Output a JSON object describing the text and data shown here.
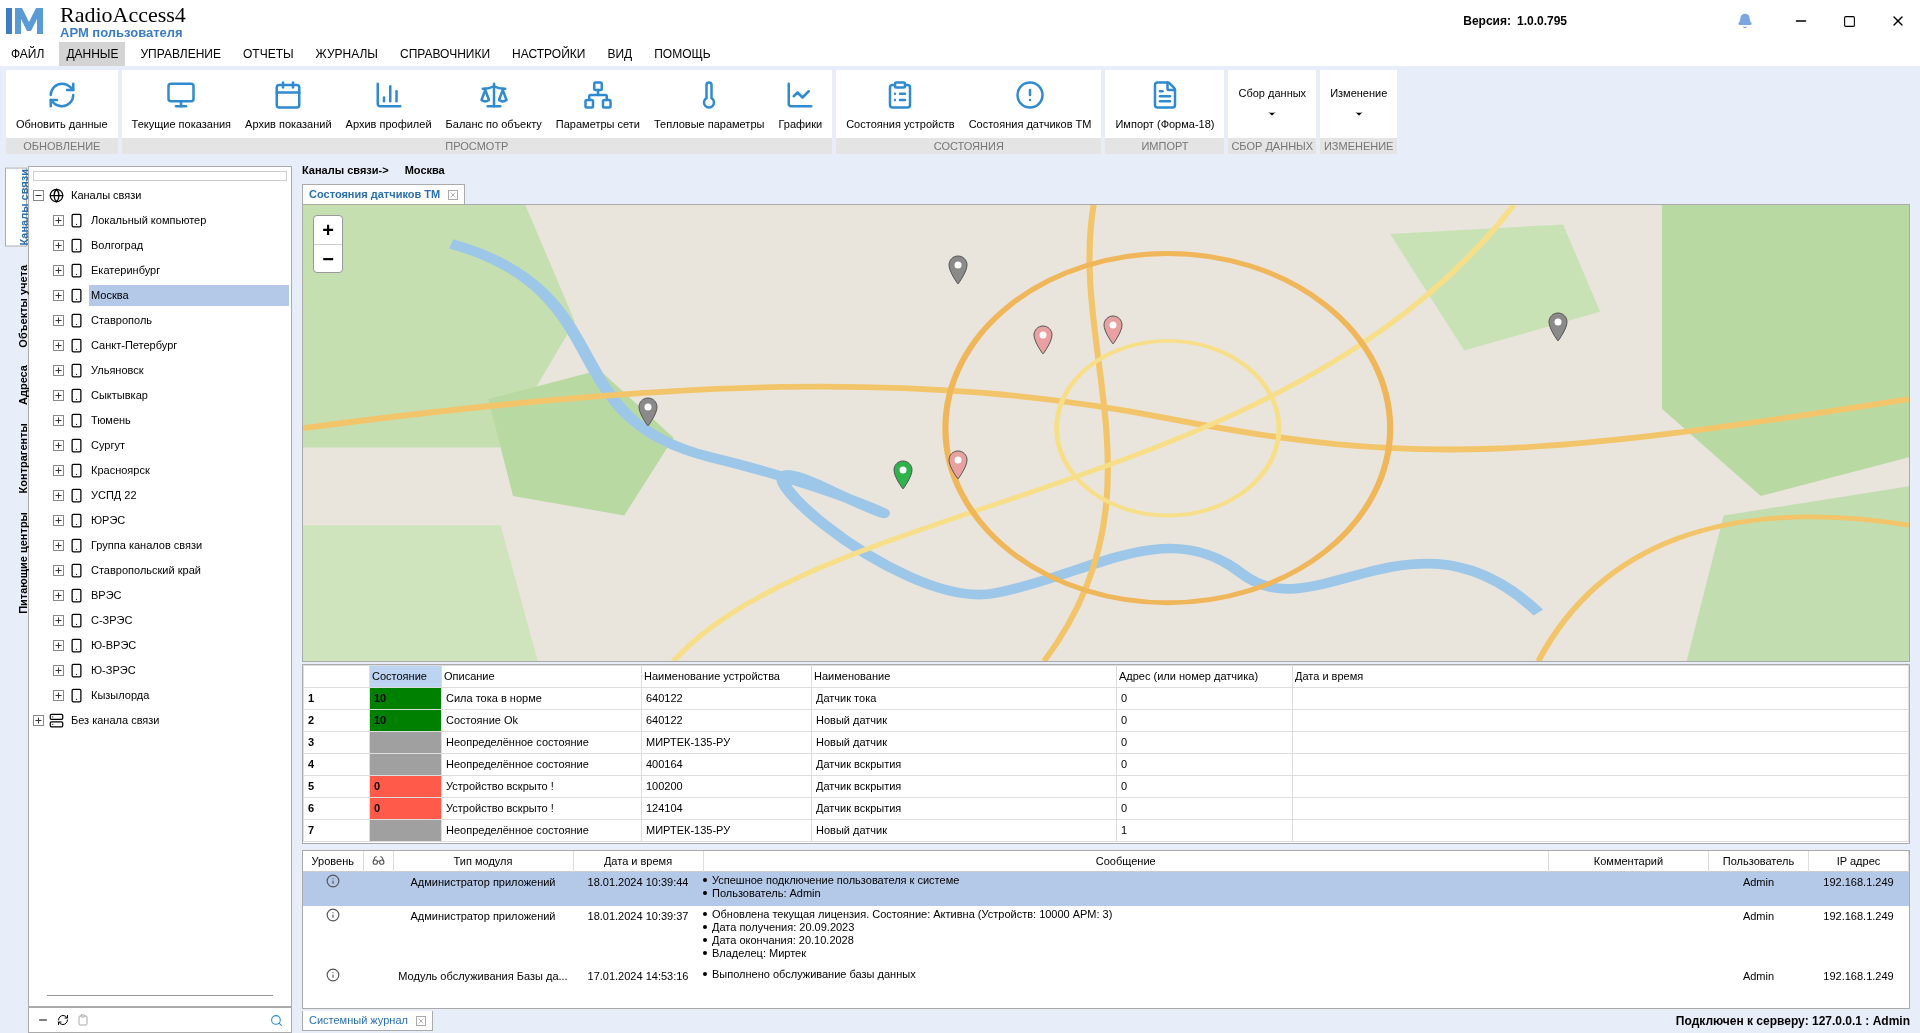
{
  "app": {
    "title": "RadioAccess4",
    "subtitle": "АРМ пользователя",
    "version_label": "Версия:",
    "version": "1.0.0.795"
  },
  "menu": [
    {
      "label": "ФАЙЛ",
      "selected": false
    },
    {
      "label": "ДАННЫЕ",
      "selected": true
    },
    {
      "label": "УПРАВЛЕНИЕ",
      "selected": false
    },
    {
      "label": "ОТЧЕТЫ",
      "selected": false
    },
    {
      "label": "ЖУРНАЛЫ",
      "selected": false
    },
    {
      "label": "СПРАВОЧНИКИ",
      "selected": false
    },
    {
      "label": "НАСТРОЙКИ",
      "selected": false
    },
    {
      "label": "ВИД",
      "selected": false
    },
    {
      "label": "ПОМОЩЬ",
      "selected": false
    }
  ],
  "ribbon": [
    {
      "label": "ОБНОВЛЕНИЕ",
      "buttons": [
        {
          "kind": "button",
          "label": "Обновить данные"
        }
      ]
    },
    {
      "label": "ПРОСМОТР",
      "buttons": [
        {
          "kind": "button",
          "label": "Текущие показания"
        },
        {
          "kind": "button",
          "label": "Архив показаний"
        },
        {
          "kind": "button",
          "label": "Архив профилей"
        },
        {
          "kind": "button",
          "label": "Баланс по объекту"
        },
        {
          "kind": "button",
          "label": "Параметры сети"
        },
        {
          "kind": "button",
          "label": "Тепловые параметры"
        },
        {
          "kind": "button",
          "label": "Графики"
        }
      ]
    },
    {
      "label": "СОСТОЯНИЯ",
      "buttons": [
        {
          "kind": "button",
          "label": "Состояния устройств"
        },
        {
          "kind": "button",
          "label": "Состояния датчиков ТМ"
        }
      ]
    },
    {
      "label": "ИМПОРТ",
      "buttons": [
        {
          "kind": "button",
          "label": "Импорт (Форма-18)"
        }
      ]
    },
    {
      "label": "СБОР ДАННЫХ",
      "buttons": [
        {
          "kind": "dropdown",
          "label": "Сбор данных"
        }
      ]
    },
    {
      "label": "ИЗМЕНЕНИЕ",
      "buttons": [
        {
          "kind": "dropdown",
          "label": "Изменение"
        }
      ]
    }
  ],
  "side_tabs": [
    {
      "label": "Каналы связи",
      "selected": true
    },
    {
      "label": "Объекты учета",
      "selected": false
    },
    {
      "label": "Адреса",
      "selected": false
    },
    {
      "label": "Контрагенты",
      "selected": false
    },
    {
      "label": "Питающие центры",
      "selected": false
    }
  ],
  "tree": [
    {
      "label": "Каналы связи",
      "kind": "root",
      "expanded": true,
      "selected": false,
      "children": [
        {
          "label": "Локальный компьютер",
          "kind": "device",
          "expanded": false,
          "selected": false
        },
        {
          "label": "Волгоград",
          "kind": "device",
          "expanded": false,
          "selected": false
        },
        {
          "label": "Екатеринбург",
          "kind": "device",
          "expanded": false,
          "selected": false
        },
        {
          "label": "Москва",
          "kind": "device",
          "expanded": false,
          "selected": true
        },
        {
          "label": "Ставрополь",
          "kind": "device",
          "expanded": false,
          "selected": false
        },
        {
          "label": "Санкт-Петербург",
          "kind": "device",
          "expanded": false,
          "selected": false
        },
        {
          "label": "Ульяновск",
          "kind": "device",
          "expanded": false,
          "selected": false
        },
        {
          "label": "Сыктывкар",
          "kind": "device",
          "expanded": false,
          "selected": false
        },
        {
          "label": "Тюмень",
          "kind": "device",
          "expanded": false,
          "selected": false
        },
        {
          "label": "Сургут",
          "kind": "device",
          "expanded": false,
          "selected": false
        },
        {
          "label": "Красноярск",
          "kind": "device",
          "expanded": false,
          "selected": false
        },
        {
          "label": "УСПД 22",
          "kind": "device",
          "expanded": false,
          "selected": false
        },
        {
          "label": "ЮРЭС",
          "kind": "device",
          "expanded": false,
          "selected": false
        },
        {
          "label": "Группа каналов связи",
          "kind": "device",
          "expanded": false,
          "selected": false
        },
        {
          "label": "Ставропольский край",
          "kind": "device",
          "expanded": false,
          "selected": false
        },
        {
          "label": "ВРЭС",
          "kind": "device",
          "expanded": false,
          "selected": false
        },
        {
          "label": "С-ЗРЭС",
          "kind": "device",
          "expanded": false,
          "selected": false
        },
        {
          "label": "Ю-ВРЭС",
          "kind": "device",
          "expanded": false,
          "selected": false
        },
        {
          "label": "Ю-ЗРЭС",
          "kind": "device",
          "expanded": false,
          "selected": false
        },
        {
          "label": "Кызылорда",
          "kind": "device",
          "expanded": false,
          "selected": false
        }
      ]
    },
    {
      "label": "Без канала связи",
      "kind": "station",
      "expanded": false,
      "selected": false
    }
  ],
  "breadcrumb": [
    "Каналы связи->",
    "Москва"
  ],
  "doc_tab": {
    "label": "Состояния датчиков ТМ"
  },
  "map": {
    "zoom_in": "+",
    "zoom_out": "−"
  },
  "table": {
    "columns": [
      {
        "label": "Состояние",
        "selected": true
      },
      {
        "label": "Описание",
        "selected": false
      },
      {
        "label": "Наименование устройства",
        "selected": false
      },
      {
        "label": "Наименование",
        "selected": false
      },
      {
        "label": "Адрес (или номер датчика)",
        "selected": false
      },
      {
        "label": "Дата и время",
        "selected": false
      }
    ],
    "rows": [
      {
        "num": "1",
        "state": "10",
        "color": "#008000",
        "description": "Сила тока в норме",
        "device": "640122",
        "name": "Датчик тока",
        "address": "0"
      },
      {
        "num": "2",
        "state": "10",
        "color": "#008000",
        "description": "Состояние Ok",
        "device": "640122",
        "name": "Новый датчик",
        "address": "0"
      },
      {
        "num": "3",
        "color": "#a0a0a0",
        "description": "Неопределённое состояние",
        "device": "МИРТЕК-135-РУ",
        "name": "Новый датчик",
        "address": "0"
      },
      {
        "num": "4",
        "color": "#a0a0a0",
        "description": "Неопределённое состояние",
        "device": "400164",
        "name": "Датчик вскрытия",
        "address": "0"
      },
      {
        "num": "5",
        "state": "0",
        "color": "#ff5a4a",
        "description": "Устройство вскрыто !",
        "device": "100200",
        "name": "Датчик вскрытия",
        "address": "0"
      },
      {
        "num": "6",
        "state": "0",
        "color": "#ff5a4a",
        "description": "Устройство вскрыто !",
        "device": "124104",
        "name": "Датчик вскрытия",
        "address": "0"
      },
      {
        "num": "7",
        "color": "#a0a0a0",
        "description": "Неопределённое состояние",
        "device": "МИРТЕК-135-РУ",
        "name": "Новый датчик",
        "address": "1"
      }
    ]
  },
  "log": {
    "columns": [
      "Уровень",
      "Тип модуля",
      "Дата и время",
      "Сообщение",
      "Комментарий",
      "Пользователь",
      "IP адрес"
    ],
    "rows": [
      {
        "selected": true,
        "module": "Администратор приложений",
        "datetime": "18.01.2024 10:39:44",
        "message": [
          "Успешное подключение пользователя к системе",
          "Пользователь: Admin"
        ],
        "user": "Admin",
        "ip": "192.168.1.249"
      },
      {
        "selected": false,
        "module": "Администратор приложений",
        "datetime": "18.01.2024 10:39:37",
        "message": [
          "Обновлена текущая лицензия. Состояние:  Активна (Устройств: 10000 АРМ: 3)",
          "Дата получения: 20.09.2023",
          "Дата окончания: 20.10.2028",
          "Владелец: Миртек"
        ],
        "user": "Admin",
        "ip": "192.168.1.249"
      },
      {
        "selected": false,
        "module": "Модуль обслуживания Базы да...",
        "datetime": "17.01.2024 14:53:16",
        "message": [
          "Выполнено обслуживание базы данных"
        ],
        "user": "Admin",
        "ip": "192.168.1.249"
      }
    ]
  },
  "log_tab": {
    "label": "Системный журнал"
  },
  "status": "Подключен к серверу: 127.0.0.1 : Admin"
}
